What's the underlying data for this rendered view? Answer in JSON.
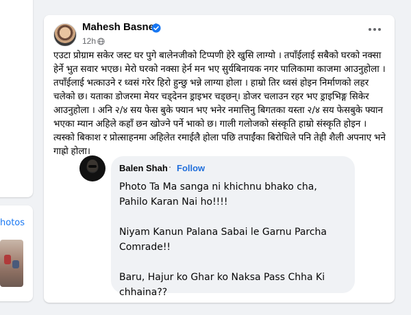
{
  "left_sidebar": {
    "photos_label": "hotos"
  },
  "post": {
    "author": "Mahesh Basnet",
    "time": "12h ·",
    "paragraphs": [
      "एउटा प्रोग्राम सकेर जस्ट घर पुगे बालेनजीको टिप्पणी हेरे खुसि लाग्यो । तपाँईलाई सबैको घरको नक्सा हेर्ने भुत सवार भएछ। मेरो घरको नक्सा हेर्न मन भए सुर्यबिनायक नगर पालिकामा काजमा आउनुहोला । तपाँईलाई भत्काउने र ध्वसं गरेर हिरो हुन्छु भन्ने लाग्या होला । हाम्रो तिर ध्वसं होइन निर्माणको लहर चलेको छ। यताका डोजरमा मेयर चड्देनन ड्राइभर चड्छन्। डोजर चलाउन रहर भए ड्राइभिङ्ग सिकेर आउनुहोला । अनि २/४ सय फेस बुके फ्यान भए भनेर नमात्तिनु बिगतका यस्ता २/४ सय फेसबुके फ्यान भएका म्यान अहिले कहाँ छन खोज्ने पर्ने भाको छ। गाली गलोजको संस्कृति हाम्रो संस्कृति होइन । त्यस्को बिकाश र प्रोत्साहनमा अहिलेत रमाईलै होला पछि तपाईंका बिरोधिले पनि तेही शैली अपनाए भने गाह्रो होला।"
    ]
  },
  "comment": {
    "author": "Balen Shah",
    "separator": "·",
    "follow_label": "Follow",
    "lines": [
      "Photo Ta Ma sanga ni khichnu bhako cha, Pahilo Karan Nai ho!!!!",
      "Niyam Kanun Palana Sabai le Garnu Parcha Comrade!!",
      "Baru, Hajur ko Ghar ko Naksa Pass Chha Ki chhaina??"
    ]
  },
  "colors": {
    "background": "#f0f2f5",
    "card": "#ffffff",
    "link_blue": "#216fdb",
    "verified_blue": "#1877f2",
    "secondary_text": "#65676b"
  },
  "icons": {
    "verified": "verified-badge-icon",
    "audience": "globe-icon",
    "more": "more-horizontal-icon"
  }
}
